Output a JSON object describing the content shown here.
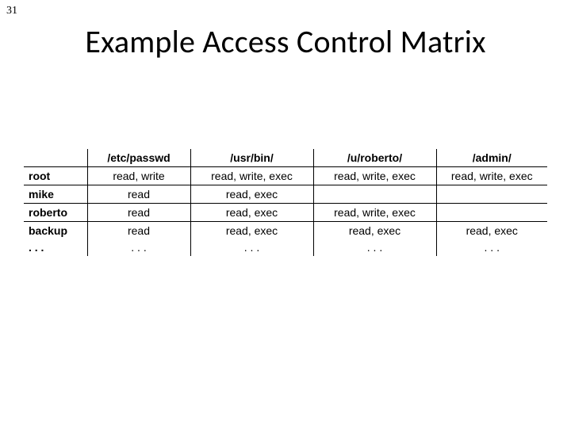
{
  "page_number": "31",
  "title": "Example Access Control Matrix",
  "table": {
    "headers": [
      "",
      "/etc/passwd",
      "/usr/bin/",
      "/u/roberto/",
      "/admin/"
    ],
    "rows": [
      {
        "label": "root",
        "cells": [
          "read, write",
          "read, write, exec",
          "read, write, exec",
          "read, write, exec"
        ]
      },
      {
        "label": "mike",
        "cells": [
          "read",
          "read, exec",
          "",
          ""
        ]
      },
      {
        "label": "roberto",
        "cells": [
          "read",
          "read, exec",
          "read, write, exec",
          ""
        ]
      },
      {
        "label": "backup",
        "cells": [
          "read",
          "read, exec",
          "read, exec",
          "read, exec"
        ]
      }
    ],
    "ellipsis": ". . .",
    "ellipsis_cells": [
      ". . .",
      ". . .",
      ". . .",
      ". . ."
    ]
  },
  "chart_data": {
    "type": "table",
    "title": "Example Access Control Matrix",
    "columns": [
      "/etc/passwd",
      "/usr/bin/",
      "/u/roberto/",
      "/admin/"
    ],
    "rows": [
      "root",
      "mike",
      "roberto",
      "backup"
    ],
    "cells": [
      [
        "read, write",
        "read, write, exec",
        "read, write, exec",
        "read, write, exec"
      ],
      [
        "read",
        "read, exec",
        "",
        ""
      ],
      [
        "read",
        "read, exec",
        "read, write, exec",
        ""
      ],
      [
        "read",
        "read, exec",
        "read, exec",
        "read, exec"
      ]
    ]
  }
}
